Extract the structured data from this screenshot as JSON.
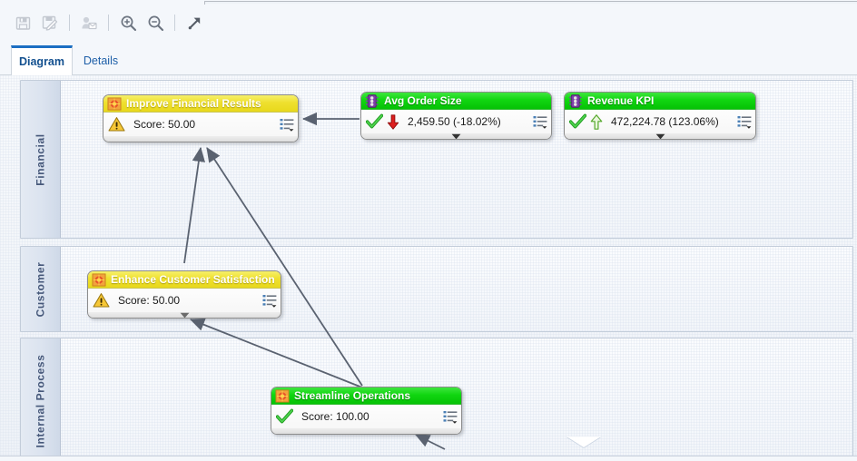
{
  "window": {
    "title": ""
  },
  "toolbar": {
    "items": [
      {
        "name": "save-icon",
        "tooltip": "Save",
        "disabled": true
      },
      {
        "name": "save-and-close-icon",
        "tooltip": "Save and Close",
        "disabled": true
      },
      {
        "name": "assign-owner-icon",
        "tooltip": "Assign",
        "disabled": true
      },
      {
        "name": "zoom-in-icon",
        "tooltip": "Zoom In",
        "disabled": false
      },
      {
        "name": "zoom-out-icon",
        "tooltip": "Zoom Out",
        "disabled": false
      },
      {
        "name": "expand-icon",
        "tooltip": "Full Screen",
        "disabled": false
      }
    ]
  },
  "tabs": [
    {
      "label": "Diagram",
      "active": true
    },
    {
      "label": "Details",
      "active": false
    }
  ],
  "lanes": [
    {
      "label": "Financial"
    },
    {
      "label": "Customer"
    },
    {
      "label": "Internal Process"
    }
  ],
  "nodes": {
    "improve_financial_results": {
      "title": "Improve Financial Results",
      "header_color": "#efe02e",
      "header_icon": "objective-target-icon",
      "status_icon": "warning-triangle-icon",
      "value": "Score: 50.00",
      "detail_icon": "detail-list-icon"
    },
    "avg_order_size": {
      "title": "Avg Order Size",
      "header_color": "#11d611",
      "header_icon": "kpi-traffic-light-icon",
      "status_icon": "green-check-icon",
      "trend_icon": "red-down-arrow-icon",
      "value": "2,459.50 (-18.02%)",
      "detail_icon": "detail-list-icon"
    },
    "revenue_kpi": {
      "title": "Revenue KPI",
      "header_color": "#11d611",
      "header_icon": "kpi-traffic-light-icon",
      "status_icon": "green-check-icon",
      "trend_icon": "green-up-arrow-icon",
      "value": "472,224.78 (123.06%)",
      "detail_icon": "detail-list-icon"
    },
    "enhance_customer_satisfaction": {
      "title": "Enhance Customer Satisfaction",
      "header_color": "#efe02e",
      "header_icon": "objective-target-icon",
      "status_icon": "warning-triangle-icon",
      "value": "Score: 50.00",
      "detail_icon": "detail-list-icon"
    },
    "streamline_operations": {
      "title": "Streamline Operations",
      "header_color": "#11d611",
      "header_icon": "objective-target-icon",
      "status_icon": "green-check-icon",
      "value": "Score: 100.00",
      "detail_icon": "detail-list-icon"
    }
  },
  "connectors": [
    {
      "from": "avg_order_size",
      "to": "improve_financial_results"
    },
    {
      "from": "enhance_customer_satisfaction",
      "to": "improve_financial_results"
    },
    {
      "from": "streamline_operations",
      "to": "improve_financial_results"
    },
    {
      "from": "streamline_operations",
      "to": "enhance_customer_satisfaction"
    }
  ],
  "scroll": {
    "down_indicator": "scroll-down-arrow"
  },
  "colors": {
    "accent": "#1b6ec2",
    "objective_yellow": "#efe02e",
    "ok_green": "#11d611",
    "warn_amber": "#f0b400",
    "bad_red": "#d81e1e",
    "canvas_bg": "#f2f5fa"
  }
}
